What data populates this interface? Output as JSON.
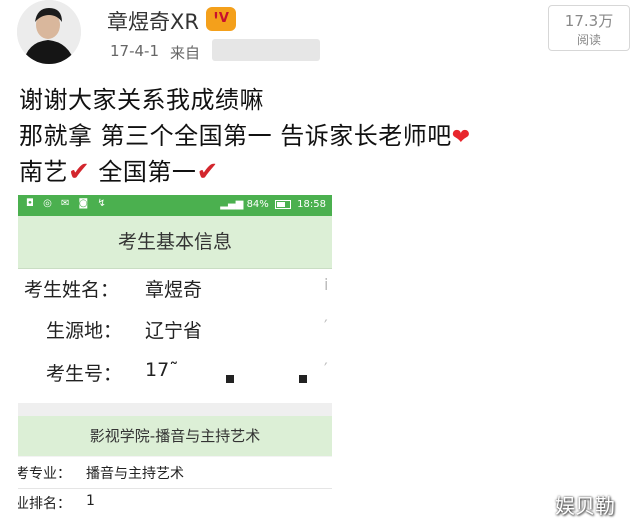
{
  "post": {
    "username": "章煜奇XR",
    "vip_badge": "ꞋV",
    "date": "17-4-1",
    "source_prefix": "来自",
    "views_count": "17.3万",
    "views_label": "阅读"
  },
  "caption": {
    "line1": "谢谢大家关系我成绩嘛",
    "line2": "那就拿  第三个全国第一  告诉家长老师吧",
    "line2_emoji": "❤",
    "line3_a": "南艺",
    "line3_b": " 全国第一",
    "check": "✔"
  },
  "phone": {
    "status_icons": "◘ ◎ ✉ ◙ ↯",
    "battery_text": "84%",
    "time": "18:58",
    "section_title": "考生基本信息",
    "rows": [
      {
        "label": "考生姓名：",
        "value": "章煜奇",
        "edge": "i"
      },
      {
        "label": "生源地：",
        "value": "辽宁省",
        "edge": "′"
      },
      {
        "label": "考生号：",
        "value": "17˜",
        "edge": "′"
      }
    ],
    "section_title2": "影视学院-播音与主持艺术",
    "rows2": [
      {
        "label": "考专业：",
        "value": "播音与主持艺术"
      },
      {
        "label": "业排名：",
        "value": "1"
      }
    ]
  },
  "watermark": "娱贝勒",
  "colors": {
    "status_bar": "#4bb04f",
    "section_bar": "#dcefd6",
    "heart": "#e8262d",
    "check": "#d3262d",
    "vip_badge": "#f4a01b"
  }
}
